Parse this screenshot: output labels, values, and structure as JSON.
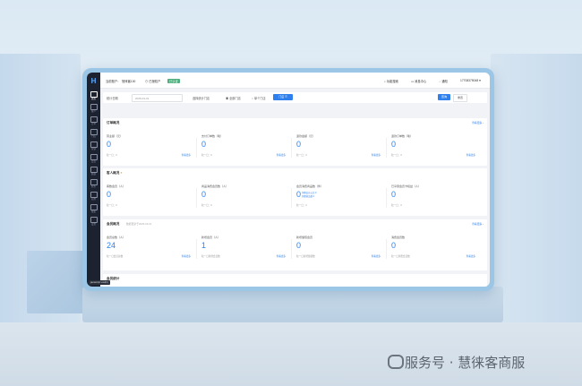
{
  "app": {
    "logo": "H",
    "topbar": {
      "breadcrumb_1": "当前账户：",
      "breadcrumb_2": "慧徕客100",
      "org_label": "⊙ 已授权户",
      "status_badge": "已认证",
      "help": "功能搜索",
      "msgs": "消息中心",
      "notify": "通知",
      "user": "17708375048"
    },
    "sidebar": {
      "items": [
        {
          "label": "首页"
        },
        {
          "label": "客户"
        },
        {
          "label": "订单"
        },
        {
          "label": "门店"
        },
        {
          "label": "营销"
        },
        {
          "label": "会员"
        },
        {
          "label": "数据"
        },
        {
          "label": "财务"
        },
        {
          "label": "应用"
        },
        {
          "label": "报表"
        },
        {
          "label": "设置"
        }
      ]
    },
    "filter": {
      "date_label": "统计日期",
      "date_value": "2025-03-01",
      "store_label": "选择统计门店",
      "store_all": "全部门店",
      "store_single": "单个门店",
      "confirm": "查询",
      "reset": "重置"
    },
    "sections": [
      {
        "title": "订单概况",
        "sub": "",
        "more": "查看更多 ›",
        "cards": [
          {
            "label": "营业额（元）",
            "value": "0",
            "note": "较一日：0",
            "link": "查看更多"
          },
          {
            "label": "支付订单数（笔）",
            "value": "0",
            "note": "较一日：0",
            "link": "查看更多"
          },
          {
            "label": "退款金额（元）",
            "value": "0",
            "note": "较一日：0",
            "link": "查看更多"
          },
          {
            "label": "退款订单数（笔）",
            "value": "0",
            "note": "较一日：0",
            "link": "查看更多"
          }
        ]
      },
      {
        "title": "客人概况",
        "sub": "",
        "more": "",
        "cards": [
          {
            "label": "客数会员（人）",
            "value": "0",
            "note": "较一日：0",
            "link": ""
          },
          {
            "label": "商品消费会员数（人）",
            "value": "0",
            "note": "较一日：0",
            "link": ""
          },
          {
            "label": "会员消费商品数（件）",
            "value": "0",
            "note": "较一日：0",
            "link": "",
            "extra_1": "消费会员占比 0",
            "extra_2": "消费商品数 0"
          },
          {
            "label": "已享受会员卡权益（人）",
            "value": "0",
            "note": "较一日：0",
            "link": ""
          }
        ]
      },
      {
        "title": "会员概况",
        "sub": "数据更新于2025-03-01",
        "more": "查看更多 ›",
        "cards": [
          {
            "label": "会员总数（人）",
            "value": "24",
            "note": "较一日会员总数",
            "link": "查看更多"
          },
          {
            "label": "新增会员（人）",
            "value": "1",
            "note": "较一日新增会员数",
            "link": "查看更多"
          },
          {
            "label": "新增储值会员",
            "value": "0",
            "note": "较一日新增储值数",
            "link": "查看更多"
          },
          {
            "label": "消费会员数",
            "value": "0",
            "note": "较一日消费会员数",
            "link": "查看更多"
          }
        ]
      }
    ],
    "next_section_title": "会员统计",
    "tooltip": "javascript:void(0);"
  },
  "watermark": "服务号 · 慧徕客商服"
}
